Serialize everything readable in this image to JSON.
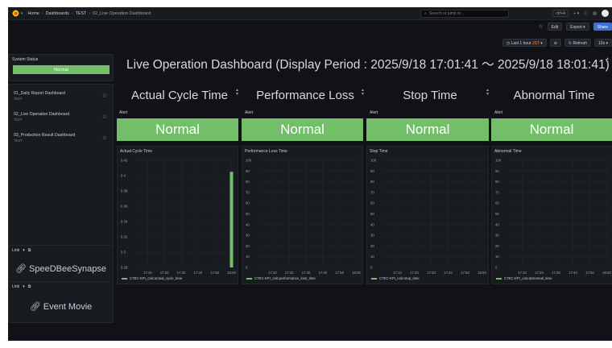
{
  "topbar": {
    "breadcrumbs": [
      "Home",
      "Dashboards",
      "TEST",
      "02_Live Operation Dashboard"
    ],
    "search_placeholder": "Search or jump to...",
    "kbd_hint": "ctrl+k",
    "plus_label": "+",
    "help_icon": "help-icon",
    "news_icon": "news-icon"
  },
  "toolbar": {
    "edit_label": "Edit",
    "export_label": "Export",
    "share_label": "Share"
  },
  "time": {
    "range_label": "Last 1 hour",
    "tz_label": "JST",
    "refresh_label": "Refresh",
    "interval_label": "10s"
  },
  "sidebar": {
    "system_status_title": "System Status",
    "system_status_value": "Normal",
    "dashboards": [
      {
        "title": "01_Daily Report Dashboard",
        "sub": "TEST"
      },
      {
        "title": "02_Live Operation Dashboard",
        "sub": "TEST"
      },
      {
        "title": "03_Production Result Dashboard",
        "sub": "TEST"
      }
    ],
    "links": [
      {
        "header": "Link",
        "text": "SpeeDBeeSynapse"
      },
      {
        "header": "Link",
        "text": "Event Movie"
      }
    ]
  },
  "dashboard_title": "Live Operation Dashboard (Display Period : 2025/9/18 17:01:41 ～ 2025/9/18 18:01:41)",
  "sections": [
    {
      "title": "Actual Cycle Time",
      "alert_label": "Alert",
      "status": "Normal",
      "chart_title": "Actual Cycle Time",
      "legend": "C7EC-KPI_calc:actual_cycle_time"
    },
    {
      "title": "Performance Loss",
      "alert_label": "Alert",
      "status": "Normal",
      "chart_title": "Performance Loss Time",
      "legend": "C7EC-KPI_calc:performance_loss_time"
    },
    {
      "title": "Stop Time",
      "alert_label": "Alert",
      "status": "Normal",
      "chart_title": "Stop Time",
      "legend": "C7EC-KPI_calc:stop_time"
    },
    {
      "title": "Abnormal Time",
      "alert_label": "Alert",
      "status": "Normal",
      "chart_title": "Abnormal Time",
      "legend": "C7EC-KPI_calc:abnormal_time"
    }
  ],
  "colors": {
    "ok": "#73bf69",
    "bg": "#111217",
    "panel": "#181b1f"
  },
  "chart_data": [
    {
      "type": "bar",
      "title": "Actual Cycle Time",
      "x_ticks": [
        "17:10",
        "17:20",
        "17:30",
        "17:40",
        "17:50",
        "18:00"
      ],
      "y_ticks": [
        "0.28",
        "0.3",
        "0.32",
        "0.34",
        "0.36",
        "0.38",
        "0.4",
        "0.42"
      ],
      "ylim": [
        0.28,
        0.42
      ],
      "series": [
        {
          "name": "C7EC-KPI_calc:actual_cycle_time",
          "x": [
            "18:00"
          ],
          "values": [
            0.405
          ]
        }
      ]
    },
    {
      "type": "line",
      "title": "Performance Loss Time",
      "x_ticks": [
        "17:10",
        "17:20",
        "17:30",
        "17:40",
        "17:50",
        "18:00"
      ],
      "y_ticks": [
        "0",
        "10",
        "20",
        "30",
        "40",
        "50",
        "60",
        "70",
        "80",
        "90",
        "100"
      ],
      "ylim": [
        0,
        100
      ],
      "series": [
        {
          "name": "C7EC-KPI_calc:performance_loss_time",
          "values": []
        }
      ]
    },
    {
      "type": "line",
      "title": "Stop Time",
      "x_ticks": [
        "17:10",
        "17:20",
        "17:30",
        "17:40",
        "17:50",
        "18:00"
      ],
      "y_ticks": [
        "0",
        "10",
        "20",
        "30",
        "40",
        "50",
        "60",
        "70",
        "80",
        "90",
        "100"
      ],
      "ylim": [
        0,
        100
      ],
      "series": [
        {
          "name": "C7EC-KPI_calc:stop_time",
          "values": []
        }
      ]
    },
    {
      "type": "line",
      "title": "Abnormal Time",
      "x_ticks": [
        "17:10",
        "17:20",
        "17:30",
        "17:40",
        "17:50",
        "18:00"
      ],
      "y_ticks": [
        "0",
        "10",
        "20",
        "30",
        "40",
        "50",
        "60",
        "70",
        "80",
        "90",
        "100"
      ],
      "ylim": [
        0,
        100
      ],
      "series": [
        {
          "name": "C7EC-KPI_calc:abnormal_time",
          "values": []
        }
      ]
    }
  ]
}
